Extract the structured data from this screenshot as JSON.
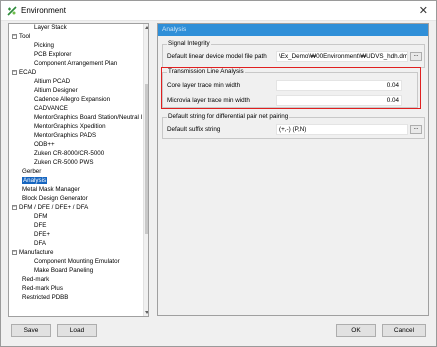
{
  "window": {
    "title": "Environment",
    "close_symbol": "✕"
  },
  "tree": {
    "items": [
      {
        "label": "Layer Stack"
      },
      {
        "label": "Tool",
        "expander": "−"
      },
      {
        "label": "Picking"
      },
      {
        "label": "PCB Explorer"
      },
      {
        "label": "Component Arrangement Plan"
      },
      {
        "label": "ECAD",
        "expander": "−"
      },
      {
        "label": "Altium PCAD"
      },
      {
        "label": "Altium Designer"
      },
      {
        "label": "Cadence Allegro Expansion"
      },
      {
        "label": "CADVANCE"
      },
      {
        "label": "MentorGraphics Board Station/Neutral I"
      },
      {
        "label": "MentorGraphics Xpedition"
      },
      {
        "label": "MentorGraphics PADS"
      },
      {
        "label": "ODB++"
      },
      {
        "label": "Zuken CR-8000/CR-5000"
      },
      {
        "label": "Zuken CR-5000 PWS"
      },
      {
        "label": "Gerber"
      },
      {
        "label": "Analysis"
      },
      {
        "label": "Metal Mask Manager"
      },
      {
        "label": "Block Design Generator"
      },
      {
        "label": "DFM / DFE / DFE+ / DFA",
        "expander": "−"
      },
      {
        "label": "DFM"
      },
      {
        "label": "DFE"
      },
      {
        "label": "DFE+"
      },
      {
        "label": "DFA"
      },
      {
        "label": "Manufacture",
        "expander": "−"
      },
      {
        "label": "Component Mounting Emulator"
      },
      {
        "label": "Make Board Paneling"
      },
      {
        "label": "Red-mark"
      },
      {
        "label": "Red-mark Plus"
      },
      {
        "label": "Restricted PDBB"
      }
    ]
  },
  "panel": {
    "header": "Analysis",
    "signal_integrity": {
      "title": "Signal Integrity",
      "label": "Default linear device model file path",
      "value": "\\Ex_Demo\\₩00Environment\\₩UDVS_hdh.dmf",
      "browse": "..."
    },
    "transmission_line": {
      "title": "Transmission Line Analysis",
      "rows": [
        {
          "label": "Core layer trace min width",
          "value": "0.04"
        },
        {
          "label": "Microvia layer trace min width",
          "value": "0.04"
        }
      ]
    },
    "diff_pair": {
      "title": "Default string for differential pair net pairing",
      "label": "Default suffix string",
      "value": "(+,-) (P,N)",
      "browse": "..."
    }
  },
  "buttons": {
    "save": "Save",
    "load": "Load",
    "ok": "OK",
    "cancel": "Cancel"
  },
  "colors": {
    "selection": "#1565c0",
    "panel_header": "#2f8fd8",
    "highlight_border": "#e02020"
  }
}
